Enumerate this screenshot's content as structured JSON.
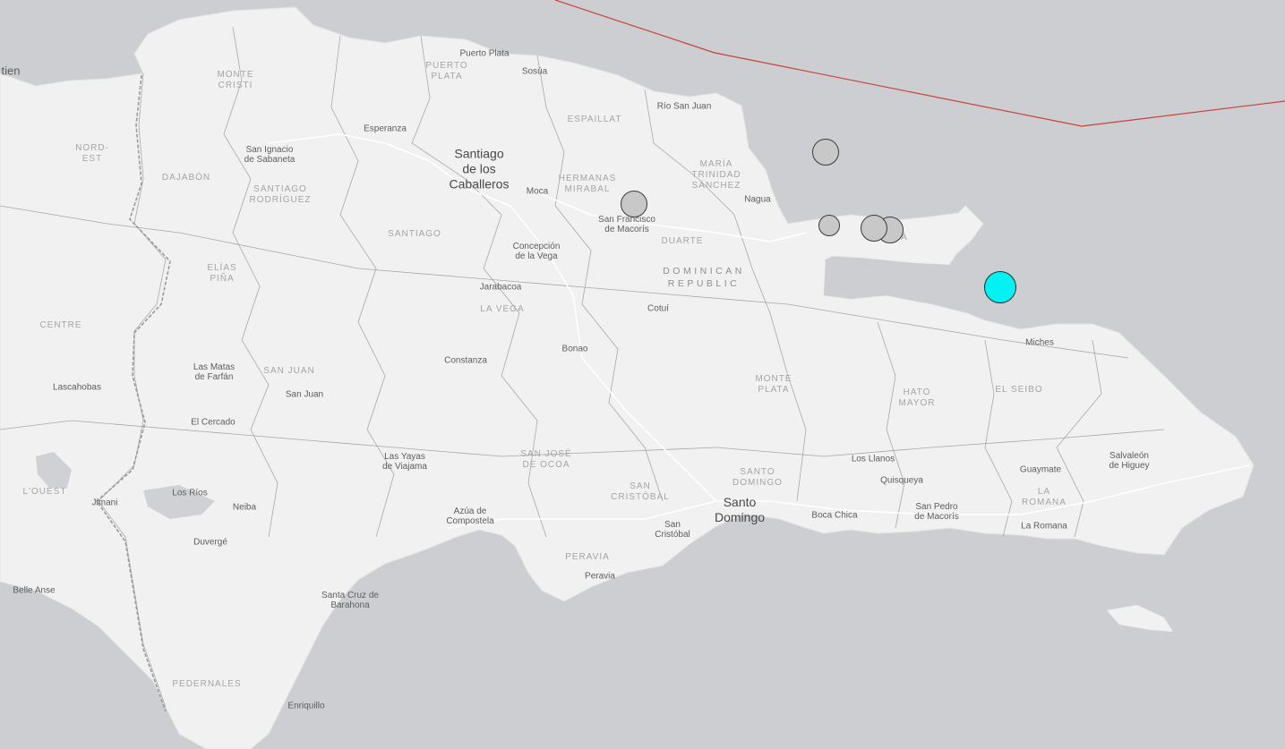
{
  "map": {
    "colors": {
      "sea": "#ccced1",
      "land": "#f1f1f1",
      "border": "#9a9a9a",
      "plate_boundary": "#c9433a",
      "quake_fill": "#c8c8c8",
      "latest_quake_fill": "#00f2f2"
    },
    "cities": [
      {
        "id": "haitien",
        "text": "tien"
      },
      {
        "id": "puerto-plata",
        "text": "Puerto Plata"
      },
      {
        "id": "sosua",
        "text": "Sosúa"
      },
      {
        "id": "rio-san-juan",
        "text": "Río San Juan"
      },
      {
        "id": "esperanza",
        "text": "Esperanza"
      },
      {
        "id": "san-ignacio",
        "text": "San Ignacio\nde Sabaneta"
      },
      {
        "id": "santiago",
        "text": "Santiago\nde los\nCaballeros"
      },
      {
        "id": "moca",
        "text": "Moca"
      },
      {
        "id": "san-francisco",
        "text": "San Francisco\nde Macorís"
      },
      {
        "id": "nagua",
        "text": "Nagua"
      },
      {
        "id": "concepcion",
        "text": "Concepción\nde la Vega"
      },
      {
        "id": "jarabacoa",
        "text": "Jarabacoa"
      },
      {
        "id": "cotui",
        "text": "Cotuí"
      },
      {
        "id": "bonao",
        "text": "Bonao"
      },
      {
        "id": "constanza",
        "text": "Constanza"
      },
      {
        "id": "miches",
        "text": "Miches"
      },
      {
        "id": "las-matas",
        "text": "Las Matas\nde Farfán"
      },
      {
        "id": "lascahobas",
        "text": "Lascahobas"
      },
      {
        "id": "san-juan",
        "text": "San Juan"
      },
      {
        "id": "el-cercado",
        "text": "El Cercado"
      },
      {
        "id": "las-yayas",
        "text": "Las Yayas\nde Viajama"
      },
      {
        "id": "los-llanos",
        "text": "Los Llanos"
      },
      {
        "id": "quisqueya",
        "text": "Quisqueya"
      },
      {
        "id": "guaymate",
        "text": "Guaymate"
      },
      {
        "id": "salvaleon",
        "text": "Salvaleón\nde Higuey"
      },
      {
        "id": "jimani",
        "text": "Jimani"
      },
      {
        "id": "los-rios",
        "text": "Los Ríos"
      },
      {
        "id": "neiba",
        "text": "Neiba"
      },
      {
        "id": "azua",
        "text": "Azúa de\nCompostela"
      },
      {
        "id": "santo-domingo",
        "text": "Santo\nDomingo"
      },
      {
        "id": "boca-chica",
        "text": "Boca Chica"
      },
      {
        "id": "san-pedro",
        "text": "San Pedro\nde Macorís"
      },
      {
        "id": "la-romana",
        "text": "La Romana"
      },
      {
        "id": "san-cristobal",
        "text": "San\nCristóbal"
      },
      {
        "id": "duverge",
        "text": "Duvergé"
      },
      {
        "id": "peravia-city",
        "text": "Peravia"
      },
      {
        "id": "belle-anse",
        "text": "Belle Anse"
      },
      {
        "id": "santa-cruz",
        "text": "Santa Cruz de\nBarahona"
      },
      {
        "id": "enriquillo",
        "text": "Enriquillo"
      }
    ],
    "regions": [
      {
        "id": "monte-cristi",
        "text": "MONTE\nCRISTI"
      },
      {
        "id": "puerto-plata-prov",
        "text": "PUERTO\nPLATA"
      },
      {
        "id": "espaillat",
        "text": "ESPAILLAT"
      },
      {
        "id": "nord-est",
        "text": "NORD-\nEST"
      },
      {
        "id": "dajabon",
        "text": "DAJABÓN"
      },
      {
        "id": "santiago-rodriguez",
        "text": "SANTIAGO\nRODRÍGUEZ"
      },
      {
        "id": "hermanas-mirabal",
        "text": "HERMANAS\nMIRABAL"
      },
      {
        "id": "maria-trinidad",
        "text": "MARÍA\nTRINIDAD\nSÁNCHEZ"
      },
      {
        "id": "santiago-prov",
        "text": "SANTIAGO"
      },
      {
        "id": "duarte",
        "text": "DUARTE"
      },
      {
        "id": "samana",
        "text": "Á"
      },
      {
        "id": "elias-pina",
        "text": "ELÍAS\nPIÑA"
      },
      {
        "id": "centre",
        "text": "CENTRE"
      },
      {
        "id": "la-vega",
        "text": "LA VEGA"
      },
      {
        "id": "san-juan-prov",
        "text": "SAN JUAN"
      },
      {
        "id": "monte-plata",
        "text": "MONTE\nPLATA"
      },
      {
        "id": "hato-mayor",
        "text": "HATO\nMAYOR"
      },
      {
        "id": "el-seibo",
        "text": "EL SEIBO"
      },
      {
        "id": "san-jose-ocoa",
        "text": "SAN JOSÉ\nDE OCOA"
      },
      {
        "id": "santo-domingo-prov",
        "text": "SANTO\nDOMINGO"
      },
      {
        "id": "san-cristobal-prov",
        "text": "SAN\nCRISTÓBAL"
      },
      {
        "id": "la-romana-prov",
        "text": "LA\nROMANA"
      },
      {
        "id": "l-ouest",
        "text": "L'OUEST"
      },
      {
        "id": "peravia-prov",
        "text": "PERAVIA"
      },
      {
        "id": "pedernales",
        "text": "PEDERNALES"
      }
    ],
    "country_label": "DOMINICAN\nREPUBLIC"
  }
}
